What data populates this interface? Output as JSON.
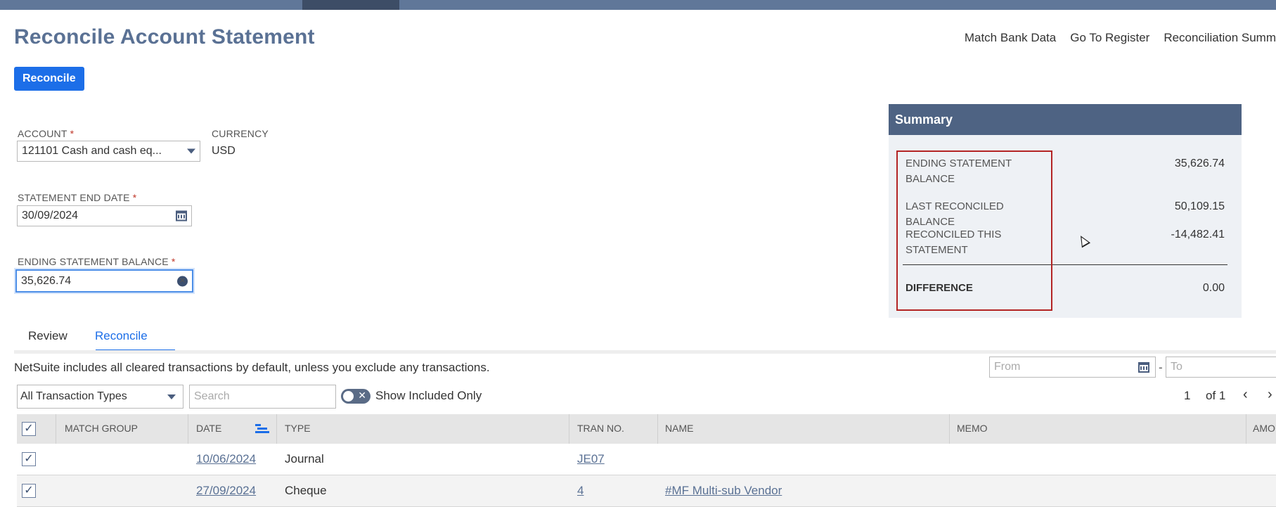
{
  "page": {
    "title": "Reconcile Account Statement"
  },
  "top_links": [
    "Match Bank Data",
    "Go To Register",
    "Reconciliation Summ"
  ],
  "actions": {
    "reconcile_label": "Reconcile"
  },
  "fields": {
    "account": {
      "label": "ACCOUNT",
      "value": "121101 Cash and cash eq...",
      "required": "*"
    },
    "currency": {
      "label": "CURRENCY",
      "value": "USD"
    },
    "statement_end_date": {
      "label": "STATEMENT END DATE",
      "value": "30/09/2024",
      "required": "*"
    },
    "ending_balance": {
      "label": "ENDING STATEMENT BALANCE",
      "value": "35,626.74",
      "required": "*"
    }
  },
  "summary": {
    "title": "Summary",
    "rows": [
      {
        "label": "ENDING STATEMENT BALANCE",
        "value": "35,626.74"
      },
      {
        "label": "LAST RECONCILED BALANCE",
        "value": "50,109.15"
      },
      {
        "label": "RECONCILED THIS STATEMENT",
        "value": "-14,482.41"
      }
    ],
    "difference": {
      "label": "DIFFERENCE",
      "value": "0.00"
    }
  },
  "tabs": {
    "review": "Review",
    "reconcile": "Reconcile",
    "active": "Reconcile"
  },
  "info_text": "NetSuite includes all cleared transactions by default, unless you exclude any transactions.",
  "date_range": {
    "from_placeholder": "From",
    "to_placeholder": "To",
    "separator": "-"
  },
  "filters": {
    "transaction_type": "All Transaction Types",
    "search_placeholder": "Search",
    "show_included_only": "Show Included Only"
  },
  "pager": {
    "page": "1",
    "of": "of 1"
  },
  "grid": {
    "columns": [
      "MATCH GROUP",
      "DATE",
      "TYPE",
      "TRAN NO.",
      "NAME",
      "MEMO",
      "AMOU"
    ],
    "rows": [
      {
        "checked": true,
        "match_group": "",
        "date": "10/06/2024",
        "type": "Journal",
        "tran_no": "JE07",
        "name": "",
        "memo": ""
      },
      {
        "checked": true,
        "match_group": "",
        "date": "27/09/2024",
        "type": "Cheque",
        "tran_no": "4",
        "name": "#MF Multi-sub Vendor",
        "memo": ""
      }
    ]
  },
  "colors": {
    "accent": "#1c6ee8",
    "title": "#5a7194",
    "summary_header": "#4e6383",
    "highlight": "#b32424"
  }
}
